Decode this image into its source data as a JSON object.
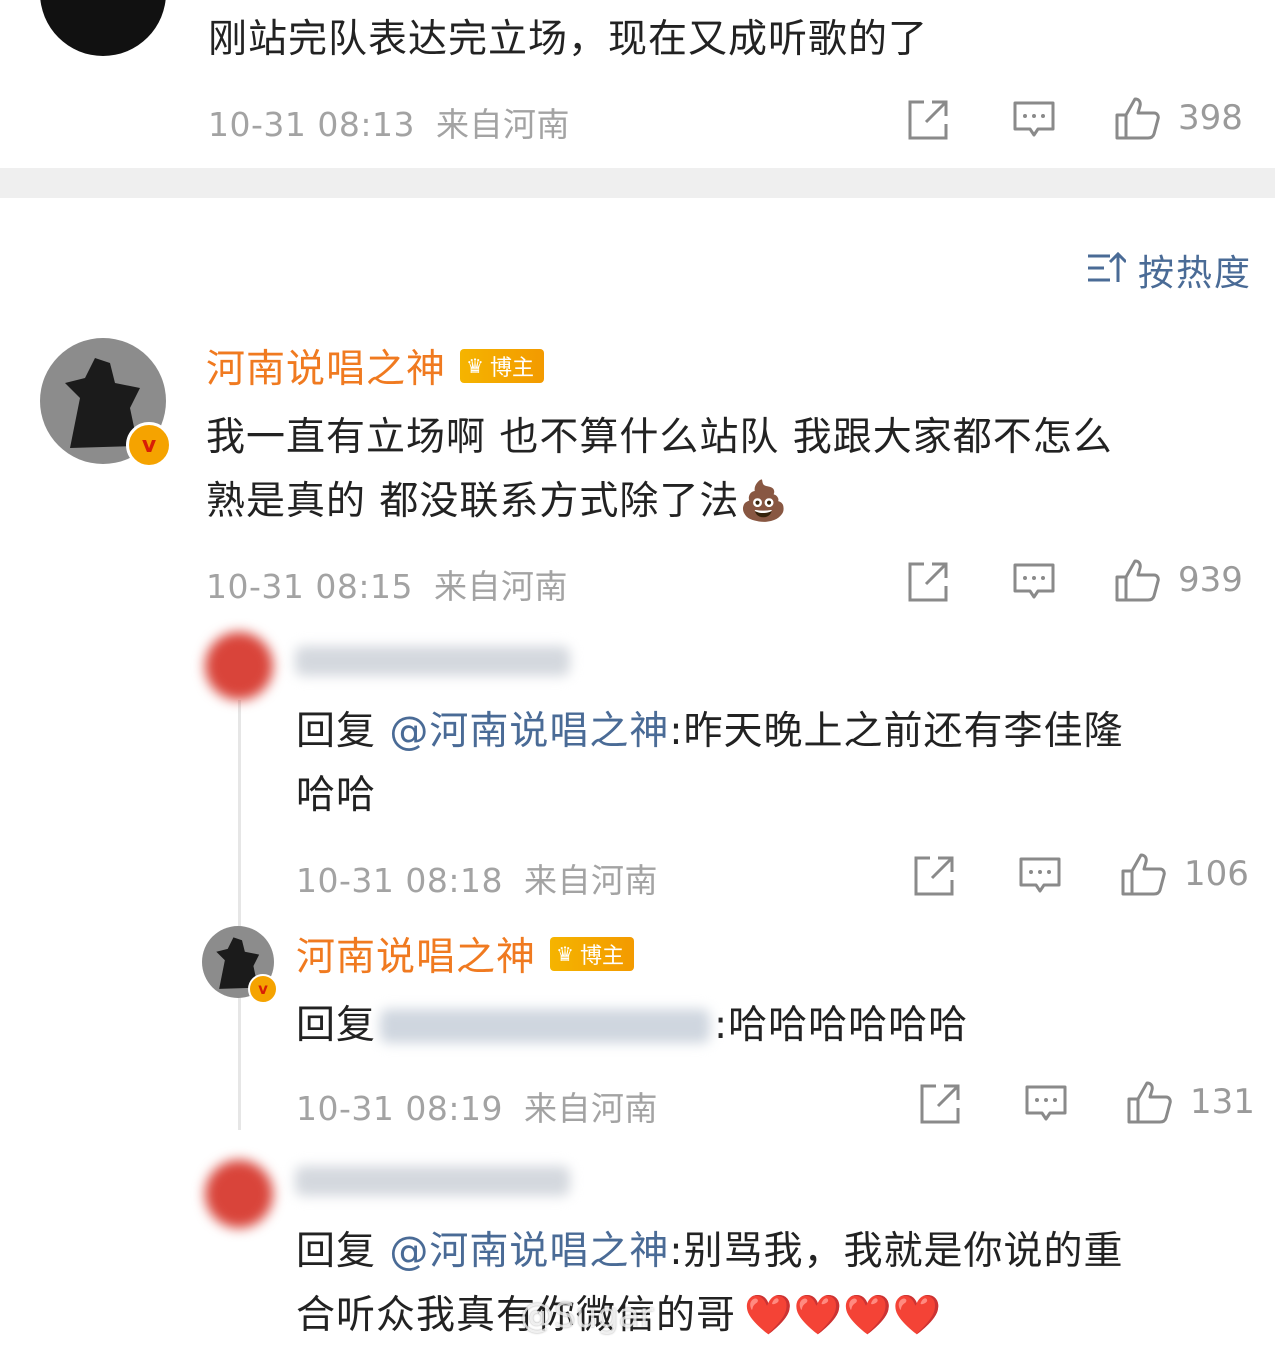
{
  "top_comment": {
    "text": "刚站完队表达完立场，现在又成听歌的了",
    "time": "10-31 08:13",
    "location": "来自河南",
    "likes": "398"
  },
  "sort": {
    "label": "按热度",
    "icon": "sort-icon"
  },
  "main_comment": {
    "author": "河南说唱之神",
    "badge": "博主",
    "text_line1": "我一直有立场啊 也不算什么站队 我跟大家都不怎么",
    "text_line2": "熟是真的 都没联系方式除了法",
    "emoji": "💩",
    "time": "10-31 08:15",
    "location": "来自河南",
    "likes": "939"
  },
  "reply1": {
    "prefix": "回复 ",
    "mention": "@河南说唱之神",
    "text_line1": ":昨天晚上之前还有李佳隆",
    "text_line2": "哈哈",
    "time": "10-31 08:18",
    "location": "来自河南",
    "likes": "106"
  },
  "reply2": {
    "author": "河南说唱之神",
    "badge": "博主",
    "prefix": "回复",
    "text": ":哈哈哈哈哈哈",
    "time": "10-31 08:19",
    "location": "来自河南",
    "likes": "131"
  },
  "reply3": {
    "prefix": "回复 ",
    "mention": "@河南说唱之神",
    "text_line1": ":别骂我，我就是你说的重",
    "text_line2": "合听众我真有你微信的哥",
    "hearts": "❤️❤️❤️❤️"
  },
  "watermark": "@Sugar"
}
